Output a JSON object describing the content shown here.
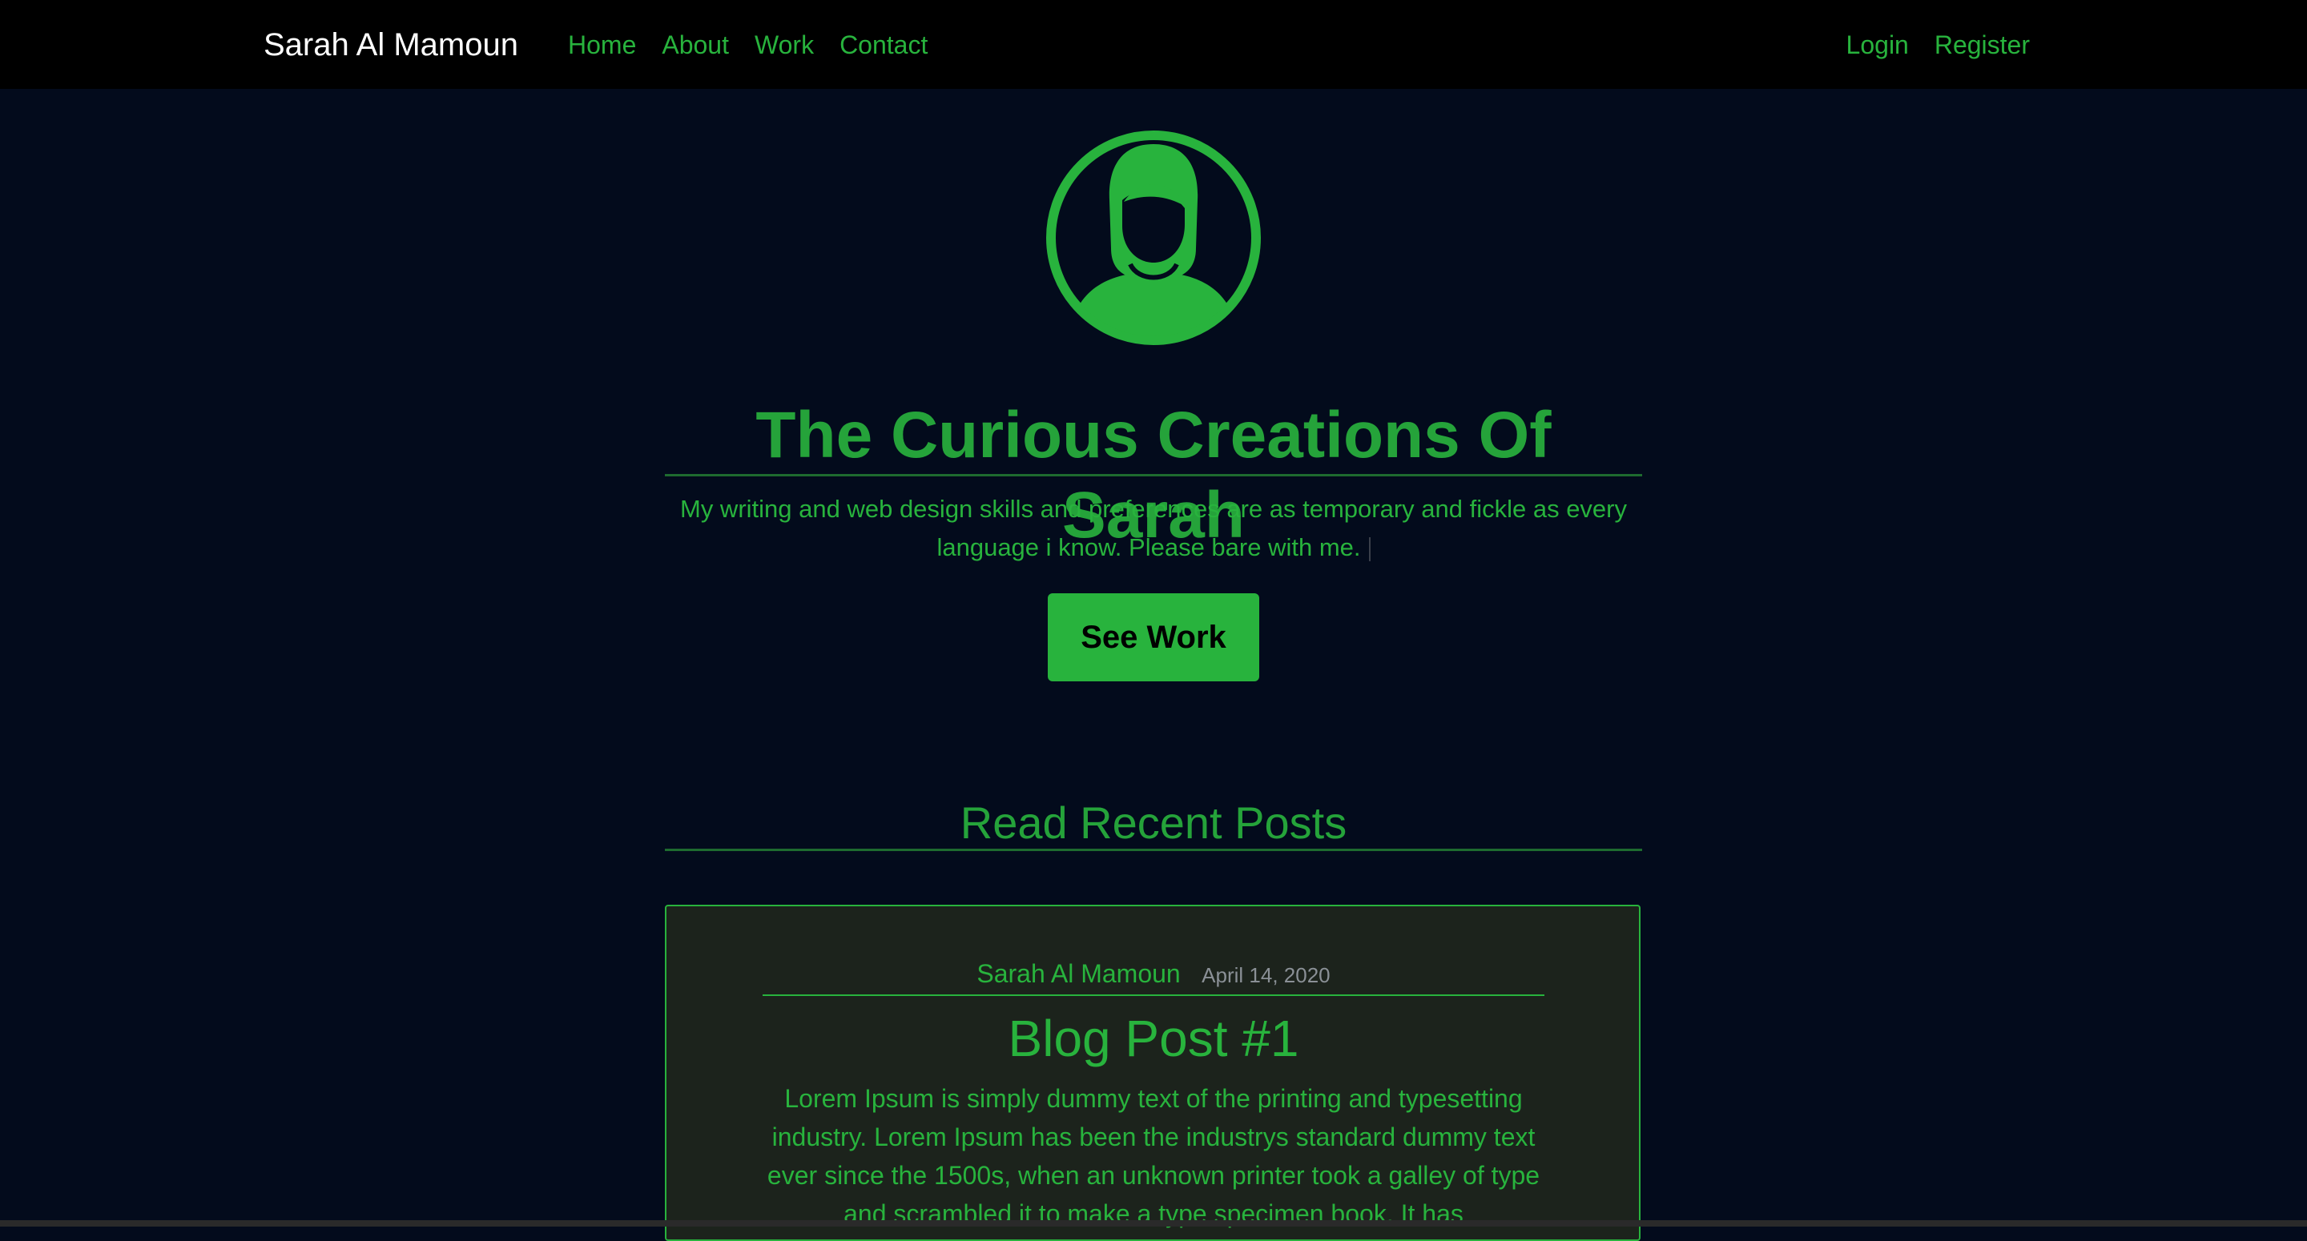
{
  "navbar": {
    "brand": "Sarah Al Mamoun",
    "links": [
      {
        "label": "Home"
      },
      {
        "label": "About"
      },
      {
        "label": "Work"
      },
      {
        "label": "Contact"
      }
    ],
    "auth": [
      {
        "label": "Login"
      },
      {
        "label": "Register"
      }
    ]
  },
  "hero": {
    "avatar_icon": "woman-avatar-icon",
    "title": "The Curious Creations Of Sarah",
    "subtitle": "My writing and web design skills and preferences are as temporary and fickle as every language i know. Please bare with me.",
    "cta_label": "See Work"
  },
  "recent": {
    "heading": "Read Recent Posts",
    "posts": [
      {
        "author": "Sarah Al Mamoun",
        "date": "April 14, 2020",
        "title": "Blog Post #1",
        "body": "Lorem Ipsum is simply dummy text of the printing and typesetting industry. Lorem Ipsum has been the industrys standard dummy text ever since the 1500s, when an unknown printer took a galley of type and scrambled it to make a type specimen book. It has"
      }
    ]
  },
  "colors": {
    "accent": "#28b33d",
    "background": "#030b1c",
    "navbar": "#000000",
    "card": "#1c231c"
  }
}
